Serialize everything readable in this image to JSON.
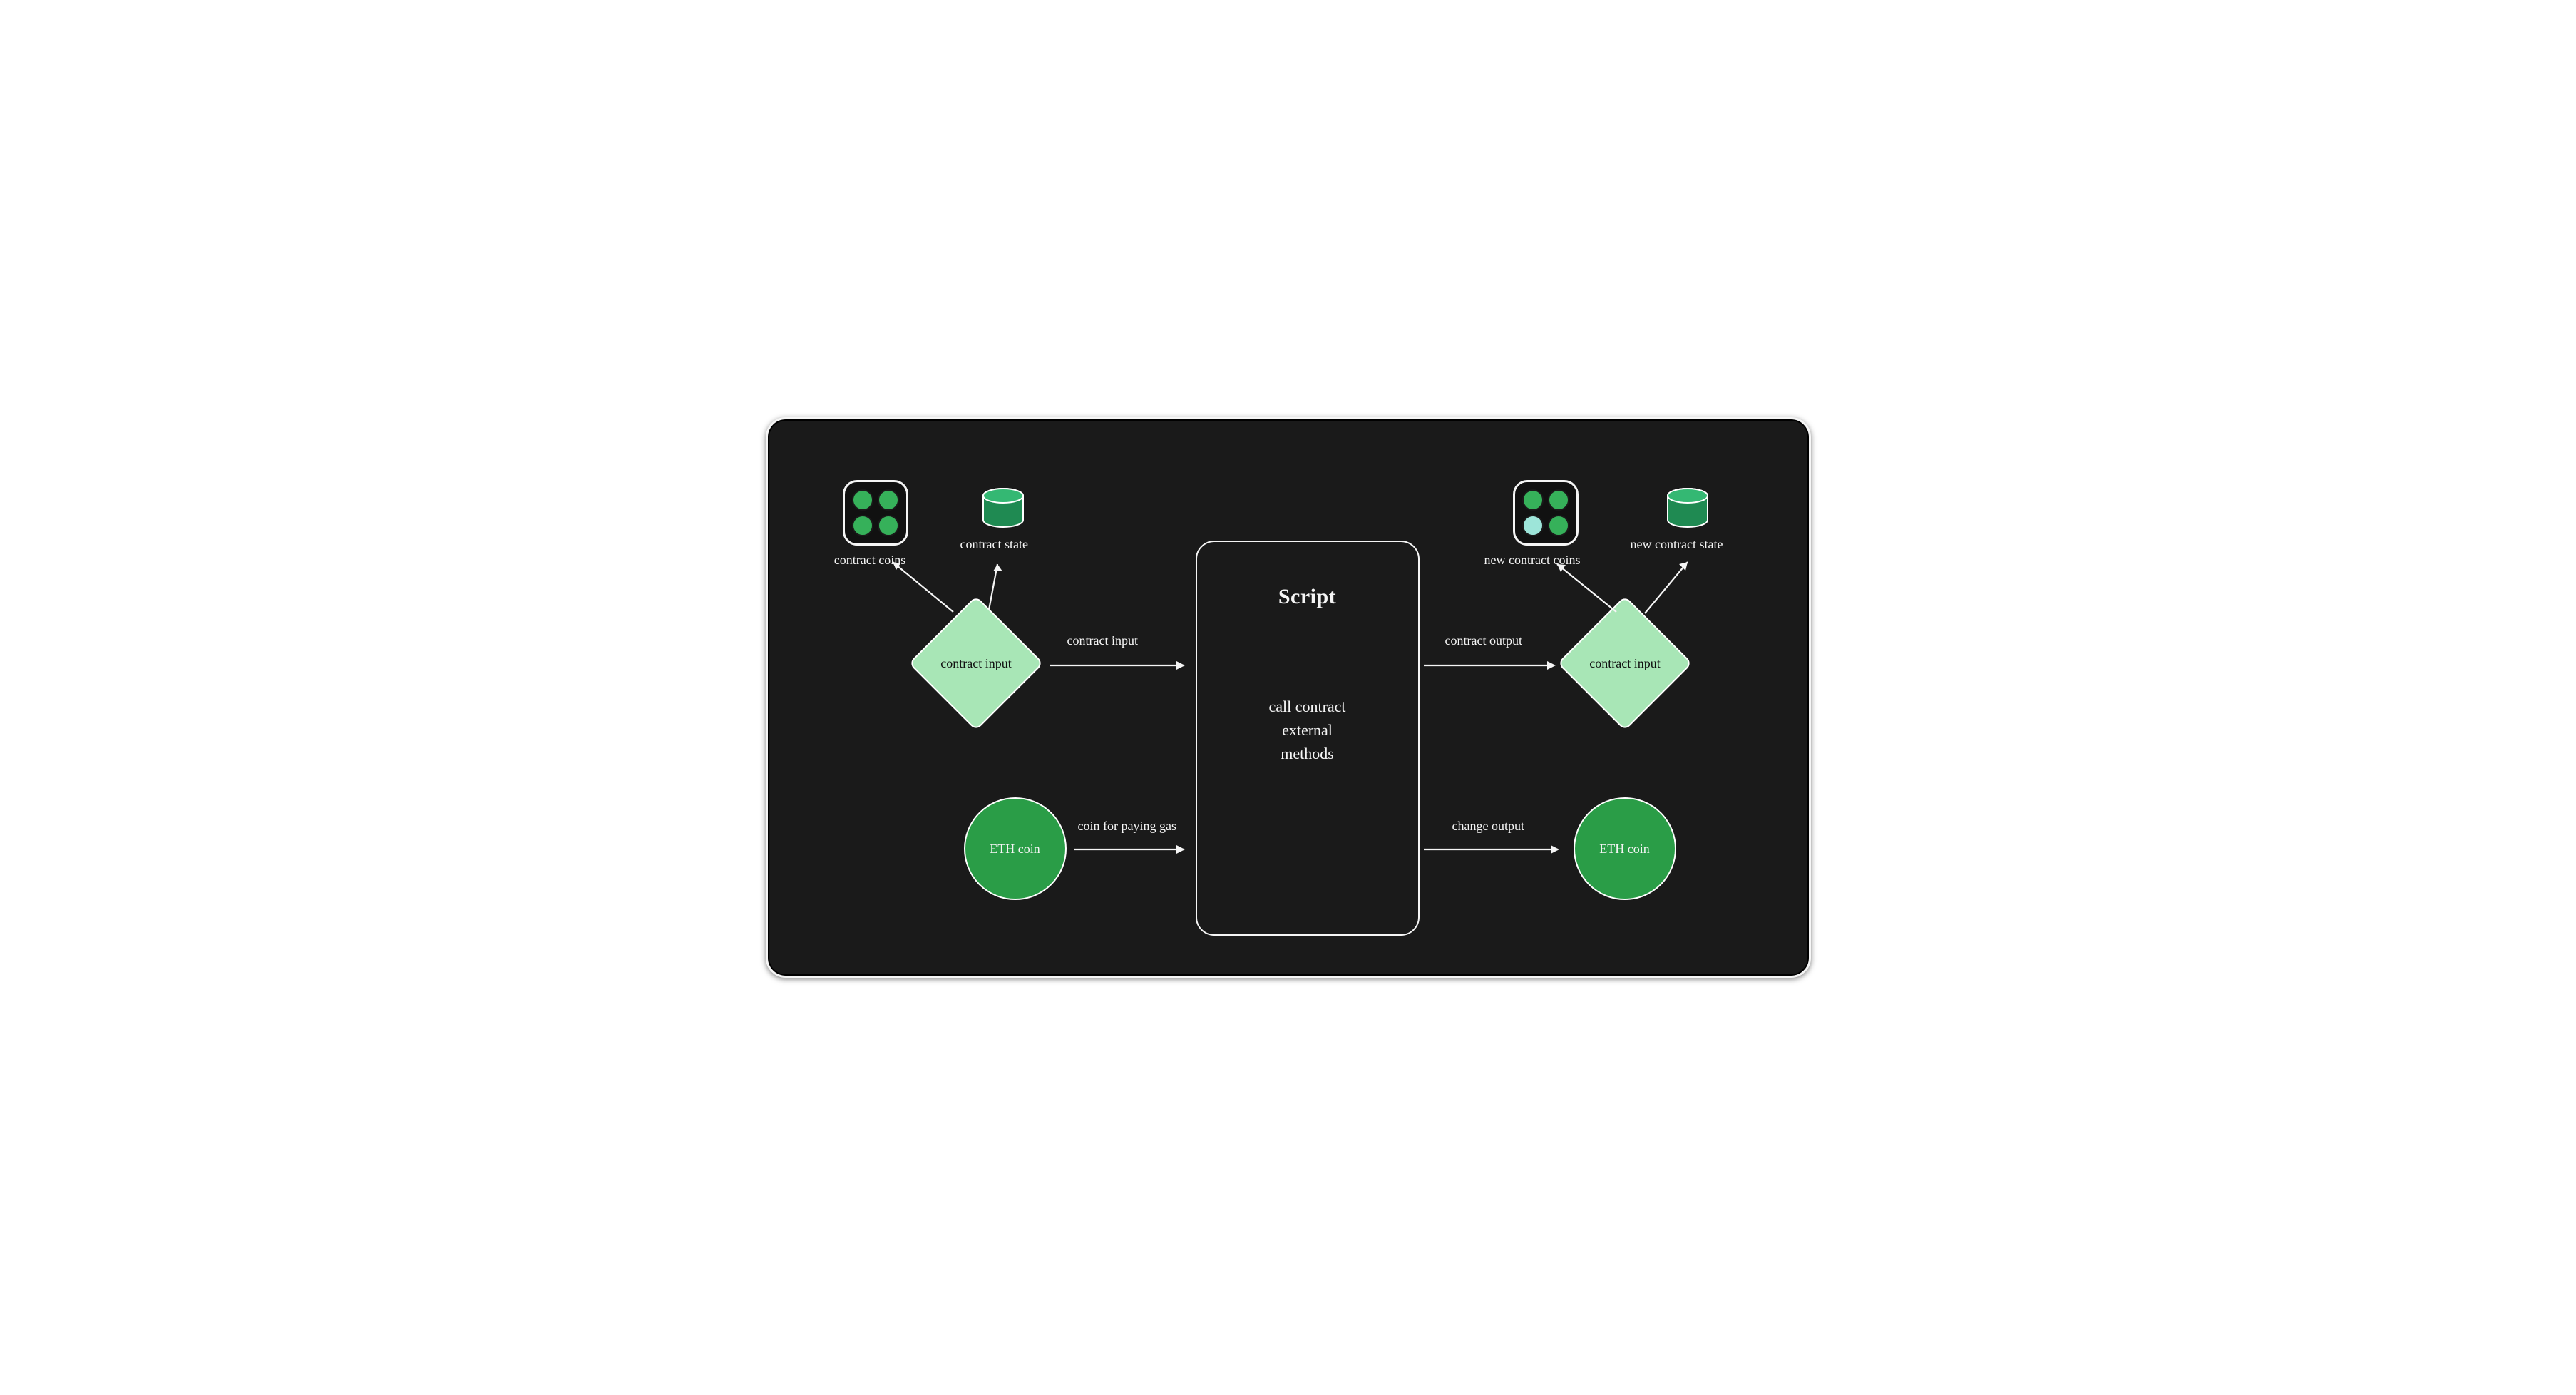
{
  "diagram": {
    "script": {
      "title": "Script",
      "body": "call contract\nexternal\nmethods"
    },
    "left": {
      "coins_label": "contract coins",
      "state_label": "contract state",
      "diamond_label": "contract input",
      "eth_label": "ETH coin"
    },
    "right": {
      "coins_label": "new contract coins",
      "state_label": "new contract state",
      "diamond_label": "contract input",
      "eth_label": "ETH coin"
    },
    "edges": {
      "ci_to_script": "contract input",
      "coin_to_script": "coin for paying gas",
      "script_to_co": "contract output",
      "script_to_eth": "change output"
    }
  }
}
